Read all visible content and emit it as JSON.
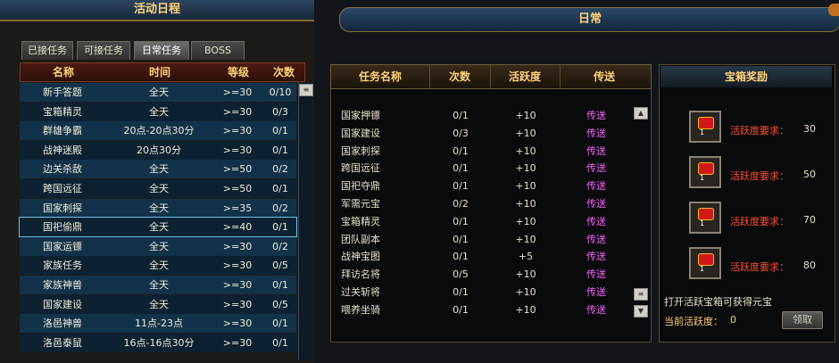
{
  "left_panel": {
    "title": "活动日程",
    "tabs": [
      "已接任务",
      "可接任务",
      "日常任务",
      "BOSS"
    ],
    "columns": [
      "名称",
      "时间",
      "等级",
      "次数"
    ],
    "rows": [
      {
        "name": "新手答题",
        "time": "全天",
        "level": ">=30",
        "count": "0/10"
      },
      {
        "name": "宝箱精灵",
        "time": "全天",
        "level": ">=30",
        "count": "0/3"
      },
      {
        "name": "群雄争霸",
        "time": "20点-20点30分",
        "level": ">=30",
        "count": "0/1"
      },
      {
        "name": "战神迷殿",
        "time": "20点30分",
        "level": ">=30",
        "count": "0/1"
      },
      {
        "name": "边关杀敌",
        "time": "全天",
        "level": ">=50",
        "count": "0/2"
      },
      {
        "name": "跨国远征",
        "time": "全天",
        "level": ">=50",
        "count": "0/1"
      },
      {
        "name": "国家刺探",
        "time": "全天",
        "level": ">=35",
        "count": "0/2"
      },
      {
        "name": "国祀偷鼎",
        "time": "全天",
        "level": ">=40",
        "count": "0/1"
      },
      {
        "name": "国家运镖",
        "time": "全天",
        "level": ">=30",
        "count": "0/2"
      },
      {
        "name": "家族任务",
        "time": "全天",
        "level": ">=30",
        "count": "0/5"
      },
      {
        "name": "家族神兽",
        "time": "全天",
        "level": ">=30",
        "count": "0/1"
      },
      {
        "name": "国家建设",
        "time": "全天",
        "level": ">=30",
        "count": "0/5"
      },
      {
        "name": "洛邑神兽",
        "time": "11点-23点",
        "level": ">=30",
        "count": "0/1"
      },
      {
        "name": "洛邑泰鼠",
        "time": "16点-16点30分",
        "level": ">=30",
        "count": "0/1"
      }
    ]
  },
  "right_panel": {
    "title": "日常",
    "task_columns": [
      "任务名称",
      "次数",
      "活跃度",
      "传送"
    ],
    "tasks": [
      {
        "name": "国家押镖",
        "count": "0/1",
        "activity": "+10",
        "teleport": "传送"
      },
      {
        "name": "国家建设",
        "count": "0/3",
        "activity": "+10",
        "teleport": "传送"
      },
      {
        "name": "国家刺探",
        "count": "0/1",
        "activity": "+10",
        "teleport": "传送"
      },
      {
        "name": "跨国远征",
        "count": "0/1",
        "activity": "+10",
        "teleport": "传送"
      },
      {
        "name": "国祀夺鼎",
        "count": "0/1",
        "activity": "+10",
        "teleport": "传送"
      },
      {
        "name": "军需元宝",
        "count": "0/2",
        "activity": "+10",
        "teleport": "传送"
      },
      {
        "name": "宝箱精灵",
        "count": "0/1",
        "activity": "+10",
        "teleport": "传送"
      },
      {
        "name": "团队副本",
        "count": "0/1",
        "activity": "+10",
        "teleport": "传送"
      },
      {
        "name": "战神宝图",
        "count": "0/1",
        "activity": "+5",
        "teleport": "传送"
      },
      {
        "name": "拜访名将",
        "count": "0/5",
        "activity": "+10",
        "teleport": "传送"
      },
      {
        "name": "过关斩将",
        "count": "0/1",
        "activity": "+10",
        "teleport": "传送"
      },
      {
        "name": "喂养坐骑",
        "count": "0/1",
        "activity": "+10",
        "teleport": "传送"
      }
    ],
    "reward_title": "宝箱奖励",
    "rewards": [
      {
        "label": "活跃度要求：",
        "value": "30",
        "qty": "1"
      },
      {
        "label": "活跃度要求：",
        "value": "50",
        "qty": "1"
      },
      {
        "label": "活跃度要求：",
        "value": "70",
        "qty": "1"
      },
      {
        "label": "活跃度要求：",
        "value": "80",
        "qty": "1"
      }
    ],
    "hint": "打开活跃宝箱可获得元宝",
    "current_activity_label": "当前活跃度：",
    "current_activity_value": "0",
    "claim_label": "领取"
  }
}
